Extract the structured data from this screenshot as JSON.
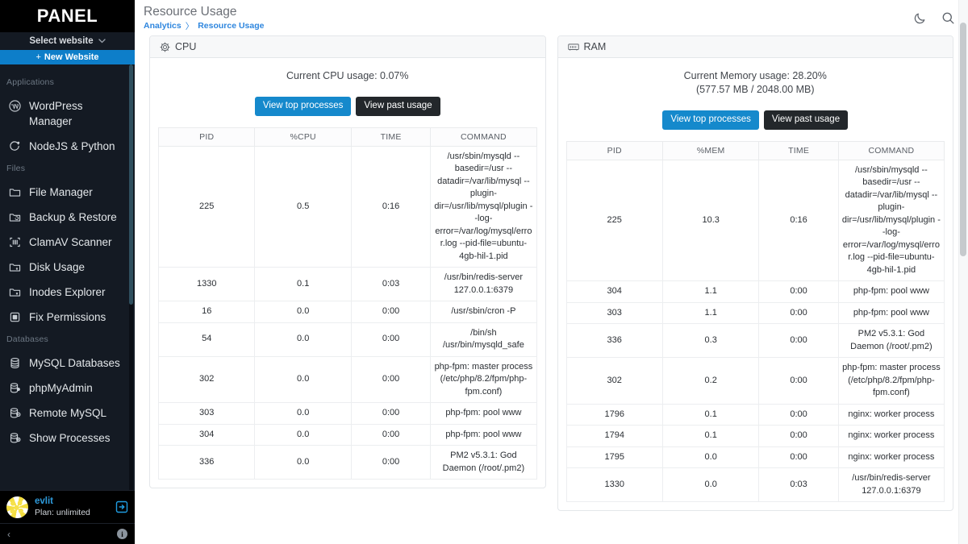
{
  "sidebar": {
    "brand": "PANEL",
    "select_website": "Select website",
    "select_caret_icon": "chevron-down-icon",
    "new_website": "New Website",
    "new_website_plus": "+",
    "groups": [
      {
        "title": "Applications",
        "items": [
          {
            "label": "WordPress Manager",
            "icon": "wordpress-icon"
          },
          {
            "label": "NodeJS & Python",
            "icon": "nodejs-python-icon"
          }
        ]
      },
      {
        "title": "Files",
        "items": [
          {
            "label": "File Manager",
            "icon": "folder-icon"
          },
          {
            "label": "Backup & Restore",
            "icon": "folder-restore-icon"
          },
          {
            "label": "ClamAV Scanner",
            "icon": "scanner-icon"
          },
          {
            "label": "Disk Usage",
            "icon": "folder-disk-icon"
          },
          {
            "label": "Inodes Explorer",
            "icon": "folder-x-icon"
          },
          {
            "label": "Fix Permissions",
            "icon": "permissions-icon"
          }
        ]
      },
      {
        "title": "Databases",
        "items": [
          {
            "label": "MySQL Databases",
            "icon": "database-icon"
          },
          {
            "label": "phpMyAdmin",
            "icon": "database-admin-icon"
          },
          {
            "label": "Remote MySQL",
            "icon": "database-remote-icon"
          },
          {
            "label": "Show Processes",
            "icon": "database-processes-icon"
          }
        ]
      }
    ],
    "user": {
      "name": "evlit",
      "plan": "Plan: unlimited",
      "logout_icon": "logout-icon",
      "avatar_icon": "avatar"
    },
    "footer": {
      "collapse_icon": "chevron-left-icon",
      "collapse_label": "‹",
      "info_icon": "info-icon",
      "info_label": "i"
    }
  },
  "header": {
    "title": "Resource Usage",
    "breadcrumbs": [
      {
        "label": "Analytics"
      },
      {
        "label": "Resource Usage"
      }
    ],
    "breadcrumb_separator": "〉",
    "actions": [
      {
        "icon": "moon-icon",
        "name": "dark-mode-toggle"
      },
      {
        "icon": "search-icon",
        "name": "search-button"
      }
    ]
  },
  "cards": {
    "cpu": {
      "icon": "gear-icon",
      "title": "CPU",
      "usage_line_1": "Current CPU usage: 0.07%",
      "usage_line_2": "",
      "btn_top": "View top processes",
      "btn_past": "View past usage",
      "columns": [
        "PID",
        "%CPU",
        "TIME",
        "COMMAND"
      ],
      "rows": [
        {
          "pid": "225",
          "val": "0.5",
          "time": "0:16",
          "cmd": "/usr/sbin/mysqld --basedir=/usr --datadir=/var/lib/mysql --plugin-dir=/usr/lib/mysql/plugin --log-error=/var/log/mysql/error.log --pid-file=ubuntu-4gb-hil-1.pid"
        },
        {
          "pid": "1330",
          "val": "0.1",
          "time": "0:03",
          "cmd": "/usr/bin/redis-server 127.0.0.1:6379"
        },
        {
          "pid": "16",
          "val": "0.0",
          "time": "0:00",
          "cmd": "/usr/sbin/cron -P"
        },
        {
          "pid": "54",
          "val": "0.0",
          "time": "0:00",
          "cmd": "/bin/sh /usr/bin/mysqld_safe"
        },
        {
          "pid": "302",
          "val": "0.0",
          "time": "0:00",
          "cmd": "php-fpm: master process (/etc/php/8.2/fpm/php-fpm.conf)"
        },
        {
          "pid": "303",
          "val": "0.0",
          "time": "0:00",
          "cmd": "php-fpm: pool www"
        },
        {
          "pid": "304",
          "val": "0.0",
          "time": "0:00",
          "cmd": "php-fpm: pool www"
        },
        {
          "pid": "336",
          "val": "0.0",
          "time": "0:00",
          "cmd": "PM2 v5.3.1: God Daemon (/root/.pm2)"
        }
      ]
    },
    "ram": {
      "icon": "memory-icon",
      "title": "RAM",
      "usage_line_1": "Current Memory usage: 28.20%",
      "usage_line_2": "(577.57 MB / 2048.00 MB)",
      "btn_top": "View top processes",
      "btn_past": "View past usage",
      "columns": [
        "PID",
        "%MEM",
        "TIME",
        "COMMAND"
      ],
      "rows": [
        {
          "pid": "225",
          "val": "10.3",
          "time": "0:16",
          "cmd": "/usr/sbin/mysqld --basedir=/usr --datadir=/var/lib/mysql --plugin-dir=/usr/lib/mysql/plugin --log-error=/var/log/mysql/error.log --pid-file=ubuntu-4gb-hil-1.pid"
        },
        {
          "pid": "304",
          "val": "1.1",
          "time": "0:00",
          "cmd": "php-fpm: pool www"
        },
        {
          "pid": "303",
          "val": "1.1",
          "time": "0:00",
          "cmd": "php-fpm: pool www"
        },
        {
          "pid": "336",
          "val": "0.3",
          "time": "0:00",
          "cmd": "PM2 v5.3.1: God Daemon (/root/.pm2)"
        },
        {
          "pid": "302",
          "val": "0.2",
          "time": "0:00",
          "cmd": "php-fpm: master process (/etc/php/8.2/fpm/php-fpm.conf)"
        },
        {
          "pid": "1796",
          "val": "0.1",
          "time": "0:00",
          "cmd": "nginx: worker process"
        },
        {
          "pid": "1794",
          "val": "0.1",
          "time": "0:00",
          "cmd": "nginx: worker process"
        },
        {
          "pid": "1795",
          "val": "0.0",
          "time": "0:00",
          "cmd": "nginx: worker process"
        },
        {
          "pid": "1330",
          "val": "0.0",
          "time": "0:03",
          "cmd": "/usr/bin/redis-server 127.0.0.1:6379"
        }
      ]
    }
  },
  "colors": {
    "accent_blue": "#1589cc",
    "dark_button": "#23272b",
    "sidebar_bg": "#141a23",
    "brand_bg": "#000000",
    "link_blue": "#2e86de"
  }
}
